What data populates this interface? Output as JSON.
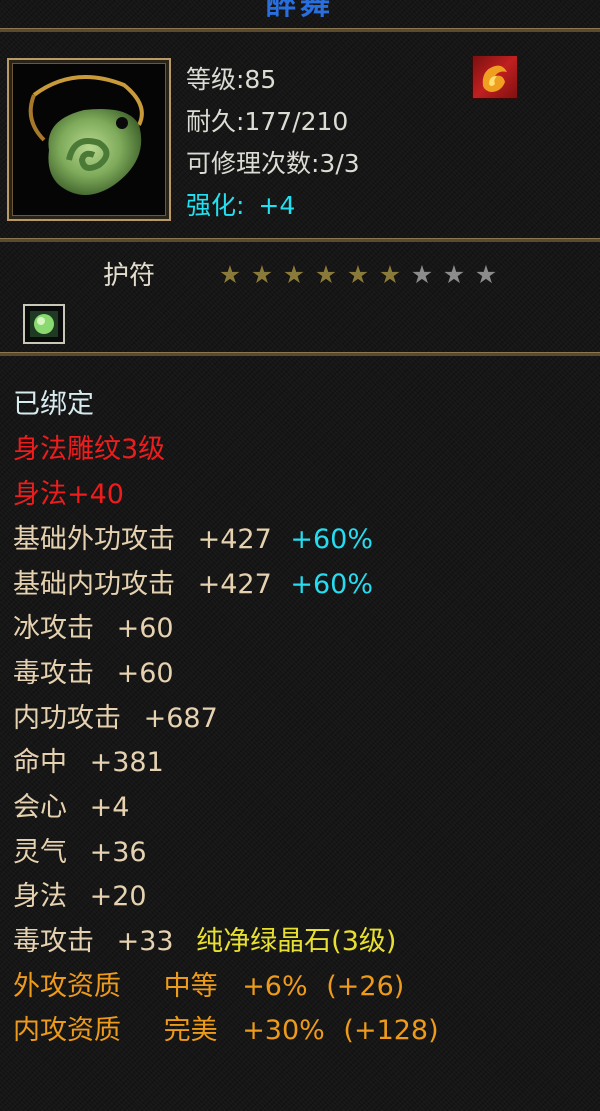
{
  "item": {
    "name": "醉舞",
    "type": "护符",
    "level_text": "等级:85",
    "durability_text": "耐久:177/210",
    "repair_text": "可修理次数:3/3",
    "enhance_label": "强化:",
    "enhance_value": "+4",
    "stars_total": 9,
    "stars_lit": 6,
    "icon": "jade-pendant-icon",
    "badge_icon": "fire-emblem-icon",
    "gem_icon": "green-gem-icon"
  },
  "attributes": {
    "bound": "已绑定",
    "engrave_title": "身法雕纹3级",
    "engrave_bonus": "身法+40",
    "ext_attack": {
      "label": "基础外功攻击",
      "value": "+427",
      "percent": "+60%"
    },
    "int_attack": {
      "label": "基础内功攻击",
      "value": "+427",
      "percent": "+60%"
    },
    "ice_attack": {
      "label": "冰攻击",
      "value": "+60"
    },
    "poison_attack": {
      "label": "毒攻击",
      "value": "+60"
    },
    "inner_attack": {
      "label": "内功攻击",
      "value": "+687"
    },
    "accuracy": {
      "label": "命中",
      "value": "+381"
    },
    "critical": {
      "label": "会心",
      "value": "+4"
    },
    "spirit": {
      "label": "灵气",
      "value": "+36"
    },
    "agility": {
      "label": "身法",
      "value": "+20"
    },
    "gem_line": {
      "label": "毒攻击",
      "value": "+33",
      "gem": "纯净绿晶石(3级)"
    },
    "ext_quality": {
      "label": "外攻资质",
      "grade": "中等",
      "percent": "+6%",
      "bonus": "(+26)"
    },
    "int_quality": {
      "label": "内攻资质",
      "grade": "完美",
      "percent": "+30%",
      "bonus": "(+128)"
    }
  },
  "colors": {
    "title": "#2a6fe0",
    "bound": "#d8ecf0",
    "engrave": "#ee1c1c",
    "stat": "#e6d2b0",
    "percent": "#26dcf0",
    "gem": "#e8e030",
    "quality": "#ee9a1a"
  }
}
